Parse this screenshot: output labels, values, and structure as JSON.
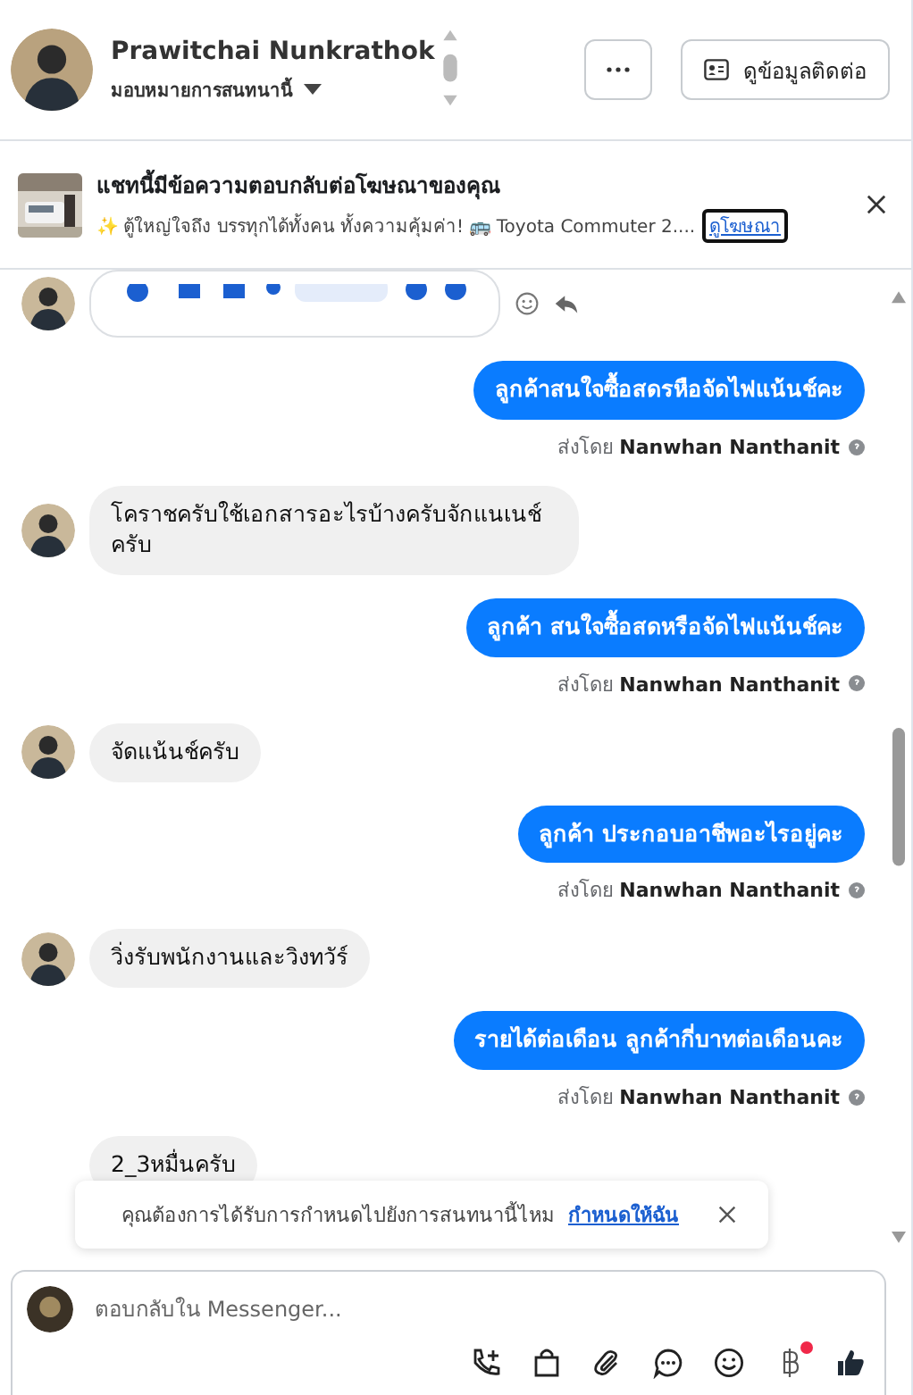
{
  "header": {
    "name": "Prawitchai Nunkrathok",
    "assign_label": "มอบหมายการสนทนานี้",
    "contact_button": "ดูข้อมูลติดต่อ"
  },
  "ad_banner": {
    "title": "แชทนี้มีข้อความตอบกลับต่อโฆษณาของคุณ",
    "description": "✨ ตู้ใหญ่ใจถึง บรรทุกได้ทั้งคน ทั้งความคุ้มค่า! 🚌 Toyota Commuter 2....",
    "link": "ดูโฆษณา",
    "link_focused": true
  },
  "messages": [
    {
      "kind": "card"
    },
    {
      "kind": "out",
      "text": "ลูกค้าสนใจซื้อสดรหือจัดไฟแน้นช์คะ",
      "sent_by": "ส่งโดย",
      "sender": "Nanwhan Nanthanit"
    },
    {
      "kind": "in",
      "text": "โคราชครับใช้เอกสารอะไรบ้างครับจักแนเนช์ครับ",
      "avatar": true
    },
    {
      "kind": "out",
      "text": "ลูกค้า  สนใจซื้อสดหรือจัดไฟแน้นช์คะ",
      "sent_by": "ส่งโดย",
      "sender": "Nanwhan Nanthanit"
    },
    {
      "kind": "in",
      "text": "จัดแน้นช์ครับ",
      "avatar": true
    },
    {
      "kind": "out",
      "text": "ลูกค้า ประกอบอาชีพอะไรอยู่คะ",
      "sent_by": "ส่งโดย",
      "sender": "Nanwhan Nanthanit"
    },
    {
      "kind": "in",
      "text": "วิ่งรับพนักงานและวิงทวัร์",
      "avatar": true
    },
    {
      "kind": "out",
      "text": "รายได้ต่อเดือน ลูกค้ากี่บาทต่อเดือนคะ",
      "sent_by": "ส่งโดย",
      "sender": "Nanwhan Nanthanit"
    },
    {
      "kind": "in",
      "text": "2_3หมื่นครับ",
      "avatar": false
    }
  ],
  "notice": {
    "text": "คุณต้องการได้รับการกำหนดไปยังการสนทนานี้ไหม",
    "link": "กำหนดให้ฉัน"
  },
  "composer": {
    "placeholder": "ตอบกลับใน Messenger...",
    "payment_notification": true
  }
}
